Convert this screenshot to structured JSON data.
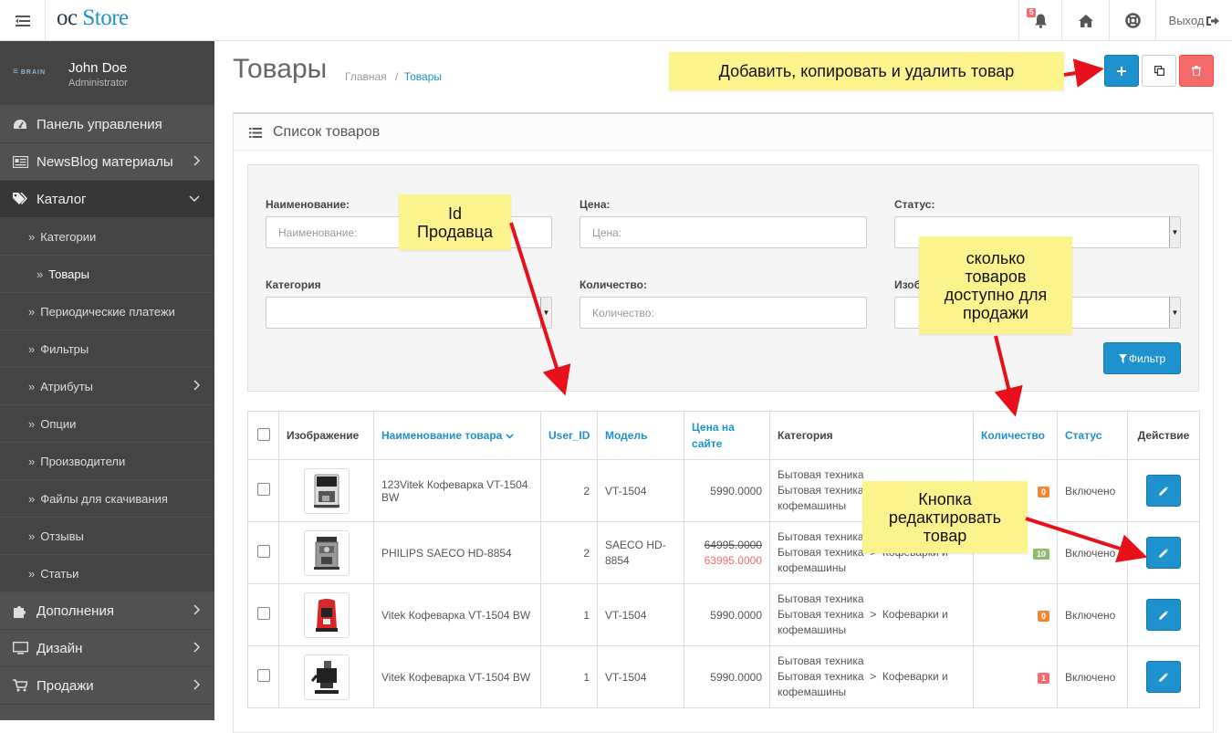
{
  "header": {
    "logo_prefix": "oc",
    "logo_suffix": "Store",
    "notifications_count": "5",
    "logout_label": "Выход"
  },
  "user": {
    "avatar_text": "BRAIN",
    "name": "John Doe",
    "role": "Administrator"
  },
  "sidebar": {
    "items": [
      {
        "label": "Панель управления",
        "icon": "dashboard-icon"
      },
      {
        "label": "NewsBlog материалы",
        "icon": "newspaper-icon"
      },
      {
        "label": "Каталог",
        "icon": "tags-icon"
      },
      {
        "label": "Дополнения",
        "icon": "puzzle-icon"
      },
      {
        "label": "Дизайн",
        "icon": "monitor-icon"
      },
      {
        "label": "Продажи",
        "icon": "cart-icon"
      }
    ],
    "catalog_sub": [
      "Категории",
      "Товары",
      "Периодические платежи",
      "Фильтры",
      "Атрибуты",
      "Опции",
      "Производители",
      "Файлы для скачивания",
      "Отзывы",
      "Статьи"
    ]
  },
  "page": {
    "title": "Товары",
    "breadcrumb_home": "Главная",
    "breadcrumb_sep": "/",
    "breadcrumb_current": "Товары"
  },
  "panel": {
    "title": "Список товаров"
  },
  "filter": {
    "name_label": "Наименование:",
    "name_placeholder": "Наименование:",
    "price_label": "Цена:",
    "price_placeholder": "Цена:",
    "status_label": "Статус:",
    "category_label": "Категория",
    "quantity_label": "Количество:",
    "quantity_placeholder": "Количество:",
    "image_label": "Изображение:",
    "filter_button": "Фильтр"
  },
  "table": {
    "headers": {
      "image": "Изображение",
      "name": "Наименование товара",
      "user_id": "User_ID",
      "model": "Модель",
      "price": "Цена на сайте",
      "category": "Категория",
      "quantity": "Количество",
      "status": "Статус",
      "action": "Действие"
    },
    "rows": [
      {
        "name": "123Vitek Кофеварка VT-1504 BW",
        "user_id": "2",
        "model": "VT-1504",
        "price": "5990.0000",
        "special": "",
        "cat1": "Бытовая техника",
        "cat2": "Бытовая техника  >  Кофеварки и",
        "cat3": "кофемашины",
        "qty": "0",
        "qty_color": "#f38733",
        "status": "Включено"
      },
      {
        "name": "PHILIPS SAECO HD-8854",
        "user_id": "2",
        "model": "SAECO HD-8854",
        "price": "64995.0000",
        "special": "63995.0000",
        "cat1": "Бытовая техника",
        "cat2": "Бытовая техника  >  Кофеварки и",
        "cat3": "кофемашины",
        "qty": "10",
        "qty_color": "#8fbb6c",
        "status": "Включено"
      },
      {
        "name": "Vitek Кофеварка VT-1504 BW",
        "user_id": "1",
        "model": "VT-1504",
        "price": "5990.0000",
        "special": "",
        "cat1": "Бытовая техника",
        "cat2": "Бытовая техника  >  Кофеварки и",
        "cat3": "кофемашины",
        "qty": "0",
        "qty_color": "#f38733",
        "status": "Включено"
      },
      {
        "name": "Vitek Кофеварка VT-1504 BW",
        "user_id": "1",
        "model": "VT-1504",
        "price": "5990.0000",
        "special": "",
        "cat1": "Бытовая техника",
        "cat2": "Бытовая техника  >  Кофеварки и",
        "cat3": "кофемашины",
        "qty": "1",
        "qty_color": "#f56b6b",
        "status": "Включено"
      }
    ]
  },
  "annotations": {
    "add_copy_delete": "Добавить, копировать и удалить товар",
    "seller_id_line1": "Id",
    "seller_id_line2": "Продавца",
    "qty_line1": "сколько",
    "qty_line2": "товаров",
    "qty_line3": "доступно для",
    "qty_line4": "продажи",
    "edit_line1": "Кнопка",
    "edit_line2": "редактировать",
    "edit_line3": "товар"
  },
  "colors": {
    "primary": "#1e91cf",
    "danger": "#f56b6b",
    "sidebar": "#515151",
    "note": "#fdf38c"
  }
}
